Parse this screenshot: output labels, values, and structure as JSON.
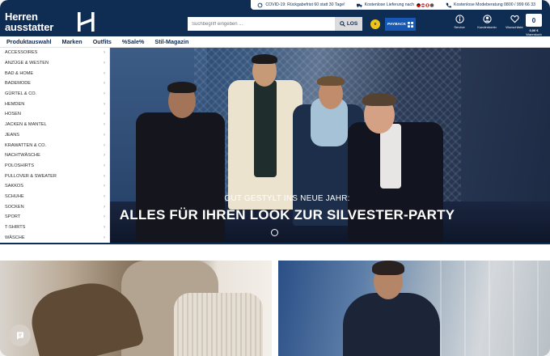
{
  "infobar": {
    "covid": "COVID-19: Rückgabefrist 60 statt 30 Tage!",
    "shipping": "Kostenlose Lieferung nach",
    "hotline": "Kostenlose Modeberatung 0800 / 999 66 33"
  },
  "header": {
    "logo_line1": "Herren",
    "logo_line2": "ausstatter",
    "search_placeholder": "Suchbegriff eingeben ...",
    "search_button": "LOS",
    "payback": "PAYBACK",
    "icons": [
      {
        "name": "service",
        "label": "Service"
      },
      {
        "name": "account",
        "label": "Kundenkonto"
      },
      {
        "name": "wishlist",
        "label": "Wunschliste"
      }
    ],
    "cart_count": "0",
    "cart_sum": "0,00 €",
    "cart_label": "Warenkorb"
  },
  "nav": [
    "Produktauswahl",
    "Marken",
    "Outfits",
    "%Sale%",
    "Stil-Magazin"
  ],
  "sidebar": [
    "ACCESSOIRES",
    "ANZÜGE & WESTEN",
    "BAD & HOME",
    "BADEMODE",
    "GÜRTEL & CO.",
    "HEMDEN",
    "HOSEN",
    "JACKEN & MANTEL",
    "JEANS",
    "KRAWATTEN & CO.",
    "NACHTWÄSCHE",
    "POLOSHIRTS",
    "PULLOVER & SWEATER",
    "SAKKOS",
    "SCHUHE",
    "SOCKEN",
    "SPORT",
    "T-SHIRTS",
    "WÄSCHE"
  ],
  "hero": {
    "subtitle": "GUT GESTYLT INS NEUE JAHR:",
    "title": "ALLES FÜR IHREN LOOK ZUR SILVESTER-PARTY"
  },
  "colors": {
    "brand": "#0f2c52",
    "accent": "#1658b4"
  }
}
